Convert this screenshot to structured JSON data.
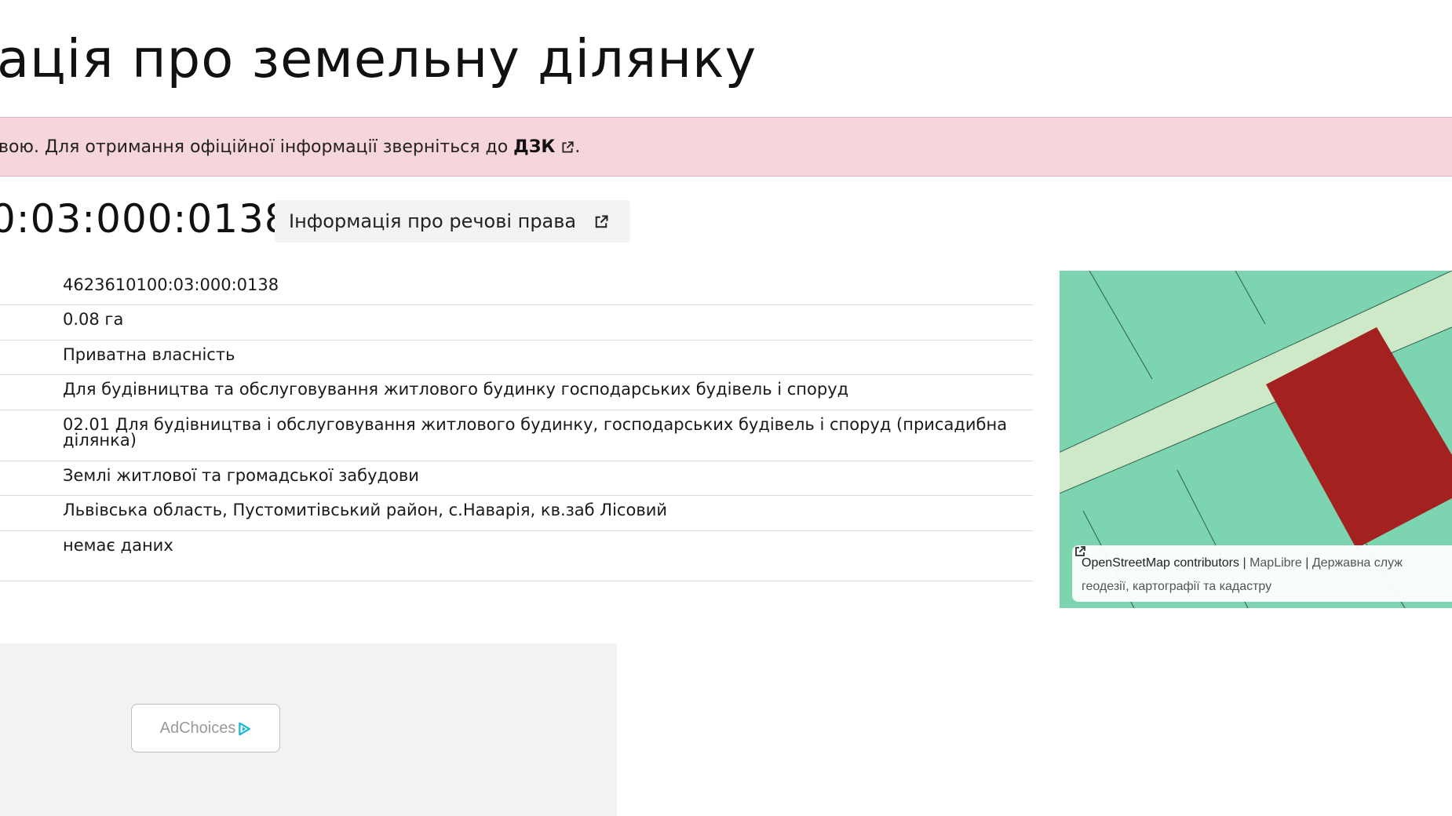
{
  "page": {
    "title": "ація про земельну ділянку"
  },
  "notice": {
    "text": "вою. Для отримання офіційної інформації зверніться до ",
    "link_label": "ДЗК",
    "suffix": "."
  },
  "parcel": {
    "cadastral_header": "0:03:000:0138",
    "rights_button_label": "Інформація про речові права",
    "rows": [
      {
        "value": "4623610100:03:000:0138"
      },
      {
        "value": "0.08 га"
      },
      {
        "value": "Приватна власність"
      },
      {
        "value": "Для будівництва та обслуговування житлового будинку господарських будівель і споруд"
      },
      {
        "value": "02.01 Для будівництва і обслуговування житлового будинку, господарських будівель і споруд (присадибна ділянка)"
      },
      {
        "value": "Землі житлової та громадської забудови"
      },
      {
        "value": "Львівська область, Пустомитівський район, с.Наварія, кв.заб Лісовий"
      },
      {
        "value": "немає даних"
      }
    ]
  },
  "map": {
    "attribution_osm": "OpenStreetMap contributors",
    "separator": "|",
    "maplibre": "MapLibre",
    "agency": "Державна служ",
    "agency_line2": "геодезії, картографії та кадастру",
    "colors": {
      "land": "#7dd4b0",
      "road": "#cde9c8",
      "parcel": "#a3221f",
      "lines": "#2f5c4b"
    }
  },
  "ad": {
    "adchoices_label": "AdChoices",
    "icon": "adchoices-icon"
  },
  "icons": {
    "external_link": "external-link-icon"
  },
  "colors": {
    "notice_bg": "#f7d5dc",
    "button_bg": "#f3f3f3",
    "ad_bg": "#f2f2f2"
  }
}
